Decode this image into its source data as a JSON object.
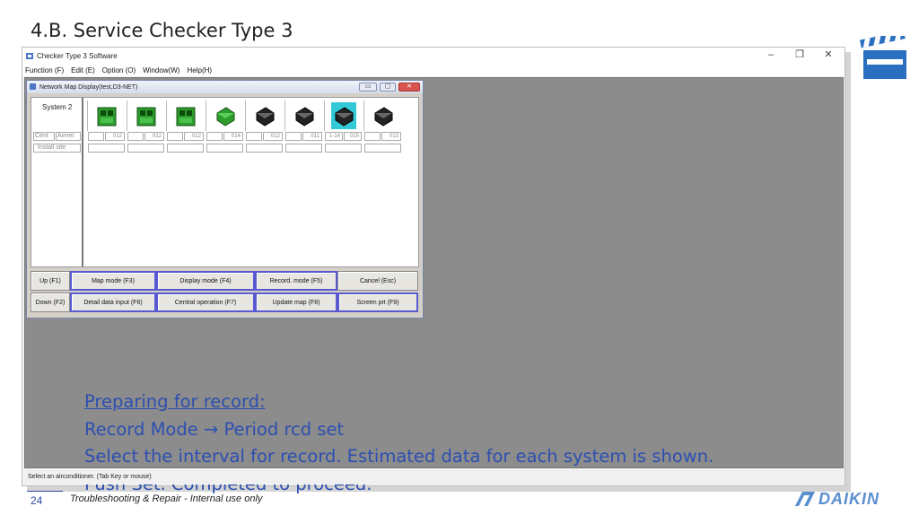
{
  "slide": {
    "title": "4.B. Service Checker Type 3",
    "page_number": "24",
    "footer_text": "Troubleshooting & Repair - Internal use only",
    "logo_text": "DAIKIN"
  },
  "app": {
    "title": "Checker Type 3 Software",
    "menu": [
      "Function (F)",
      "Edit (E)",
      "Option (O)",
      "Window(W)",
      "Help(H)"
    ],
    "status": "Select an airconditioner. (Tab Key or mouse)"
  },
  "child_window": {
    "title": "Network Map Display(test,D3-NET)",
    "system_label": "System 2",
    "row_labels": [
      "Cent",
      "Airnet",
      "Install site"
    ],
    "units": [
      {
        "state": "green",
        "airnet": "012",
        "cent": ""
      },
      {
        "state": "green",
        "airnet": "012",
        "cent": ""
      },
      {
        "state": "green",
        "airnet": "012",
        "cent": ""
      },
      {
        "state": "green-indoor",
        "airnet": "014",
        "cent": ""
      },
      {
        "state": "black",
        "airnet": "012",
        "cent": ""
      },
      {
        "state": "black",
        "airnet": "011",
        "cent": ""
      },
      {
        "state": "selected",
        "airnet": "015",
        "cent": "1-14"
      },
      {
        "state": "black",
        "airnet": "013",
        "cent": ""
      }
    ],
    "buttons_row1": [
      "Up (F1)",
      "Map mode (F3)",
      "Display mode (F4)",
      "Record. mode (F5)",
      "Cancel (Esc)"
    ],
    "buttons_row2": [
      "Down (F2)",
      "Detail data input (F6)",
      "Central operation (F7)",
      "Update map (F8)",
      "Screen prt (F9)"
    ]
  },
  "note": {
    "line1": "Preparing for record:",
    "line2": "Record Mode → Period rcd set",
    "line3": "Select the interval for record. Estimated data for each system is shown.",
    "line4": "Push Set. Completed to proceed."
  },
  "colors": {
    "note_text": "#2d4fb0",
    "unit_green": "#2e9b2e",
    "unit_selected_bg": "#33c9d6",
    "client_bg": "#8c8c8c"
  }
}
